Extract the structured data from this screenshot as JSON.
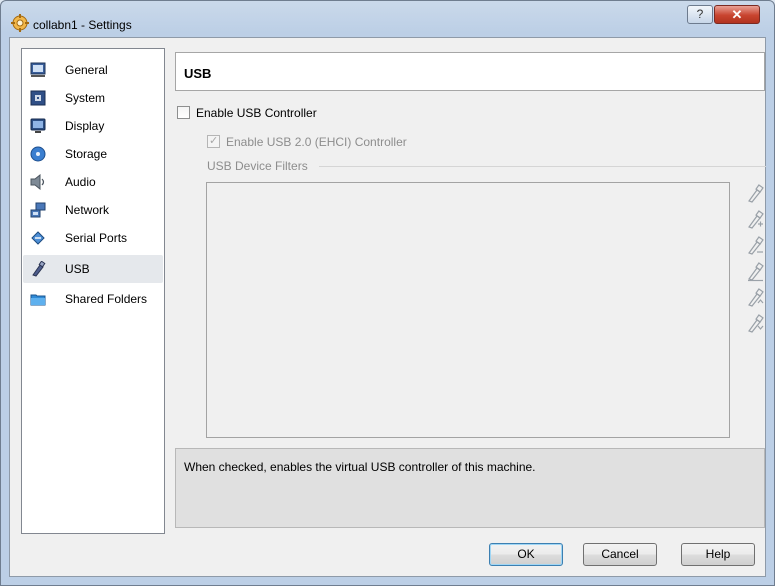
{
  "window": {
    "title": "collabn1 - Settings",
    "help_glyph": "?",
    "close_glyph": "✕"
  },
  "sidebar": {
    "items": [
      {
        "label": "General",
        "icon": "general-icon"
      },
      {
        "label": "System",
        "icon": "system-icon"
      },
      {
        "label": "Display",
        "icon": "display-icon"
      },
      {
        "label": "Storage",
        "icon": "storage-icon"
      },
      {
        "label": "Audio",
        "icon": "audio-icon"
      },
      {
        "label": "Network",
        "icon": "network-icon"
      },
      {
        "label": "Serial Ports",
        "icon": "serial-ports-icon"
      },
      {
        "label": "USB",
        "icon": "usb-icon",
        "selected": true
      },
      {
        "label": "Shared Folders",
        "icon": "shared-folders-icon"
      }
    ]
  },
  "main": {
    "header": "USB",
    "enable_usb_controller": {
      "label": "Enable USB Controller",
      "checked": false
    },
    "enable_usb2": {
      "label": "Enable USB 2.0 (EHCI) Controller",
      "checked": true,
      "disabled": true
    },
    "filters_group_label": "USB Device Filters",
    "filter_tools": [
      "add-filter-icon",
      "add-filter-from-device-icon",
      "edit-filter-icon",
      "remove-filter-icon",
      "move-filter-up-icon",
      "move-filter-down-icon"
    ],
    "info_text": "When checked, enables the virtual USB controller of this machine."
  },
  "buttons": {
    "ok": "OK",
    "cancel": "Cancel",
    "help": "Help"
  },
  "colors": {
    "title_bar": "#bccfe6",
    "close_button": "#c8442f",
    "selected_item": "#e5e8ec"
  }
}
